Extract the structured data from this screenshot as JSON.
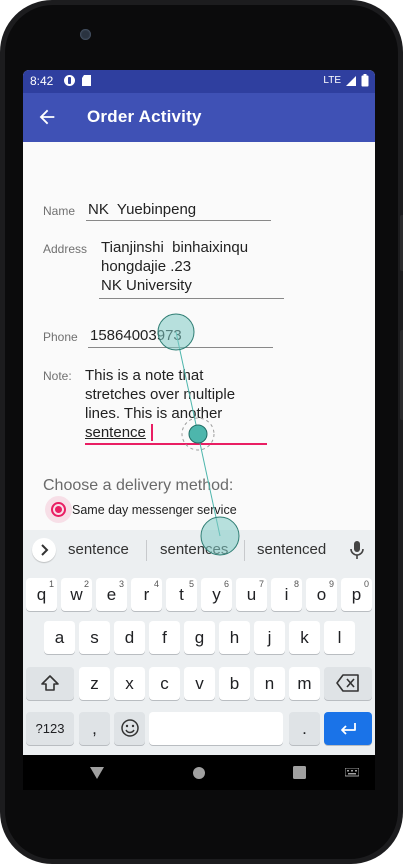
{
  "status_bar": {
    "time": "8:42",
    "network": "LTE"
  },
  "app_bar": {
    "title": "Order Activity"
  },
  "form": {
    "name_label": "Name",
    "name_value": "NK  Yuebinpeng",
    "address_label": "Address",
    "address_lines": [
      "Tianjinshi  binhaixinqu",
      "hongdajie .23",
      "NK University"
    ],
    "phone_label": "Phone",
    "phone_value": "15864003973",
    "note_label": "Note:",
    "note_lines": [
      "This is a note that",
      "stretches over multiple",
      "lines. This is another",
      "sentence"
    ]
  },
  "delivery": {
    "heading": "Choose a delivery method:",
    "option_selected": "Same day messenger service"
  },
  "keyboard": {
    "suggestions": [
      "sentence",
      "sentences",
      "sentenced"
    ],
    "row1": [
      "q",
      "w",
      "e",
      "r",
      "t",
      "y",
      "u",
      "i",
      "o",
      "p"
    ],
    "row1_hints": [
      "1",
      "2",
      "3",
      "4",
      "5",
      "6",
      "7",
      "8",
      "9",
      "0"
    ],
    "row2": [
      "a",
      "s",
      "d",
      "f",
      "g",
      "h",
      "j",
      "k",
      "l"
    ],
    "row3": [
      "z",
      "x",
      "c",
      "v",
      "b",
      "n",
      "m"
    ],
    "symbols_label": "?123",
    "comma_label": ",",
    "period_label": "."
  },
  "colors": {
    "primary": "#3f51b5",
    "status": "#2f3f9f",
    "accent": "#e91e63",
    "enter": "#1a73e8",
    "touch": "#80cbc4"
  }
}
